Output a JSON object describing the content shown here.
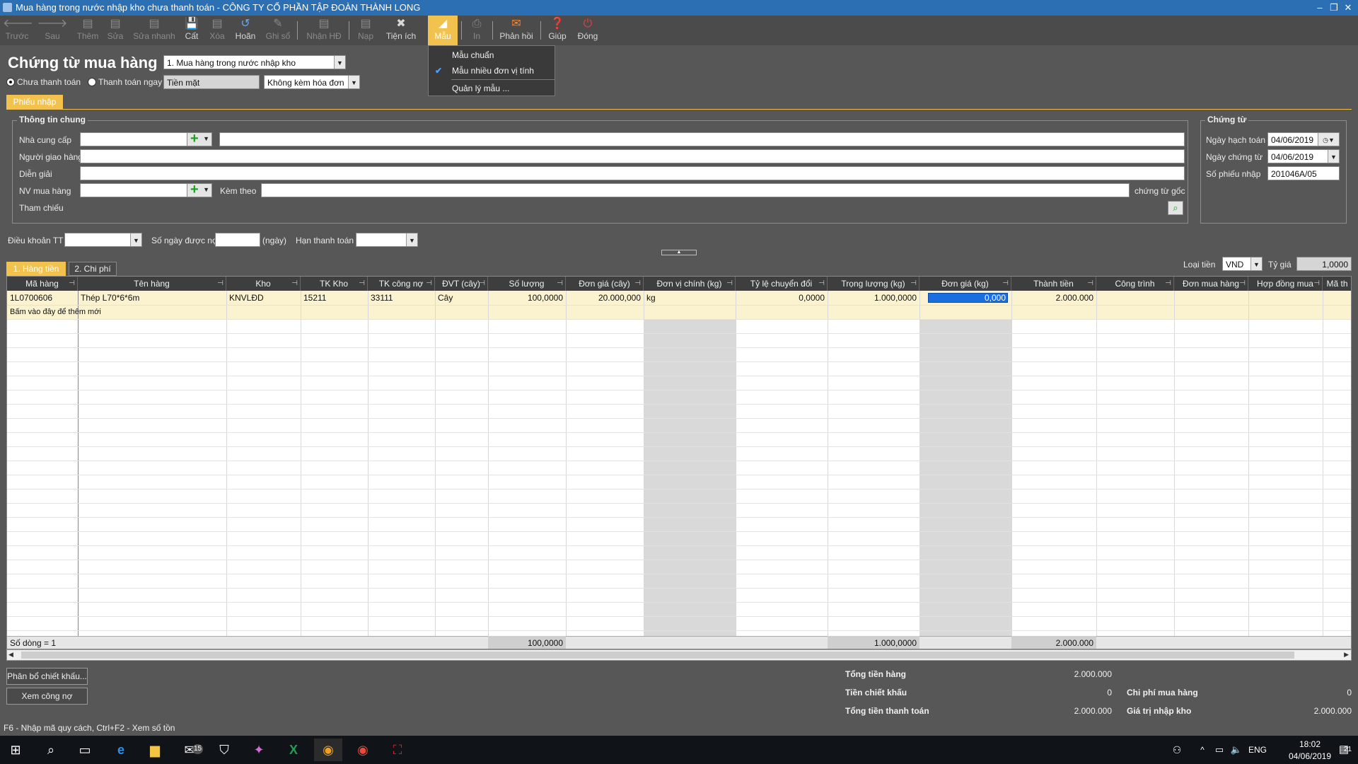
{
  "window": {
    "title": "Mua hàng trong nước nhập kho chưa thanh toán - CÔNG TY CỔ PHẦN TẬP ĐOÀN THÀNH LONG"
  },
  "toolbar": {
    "items": [
      {
        "name": "back",
        "label": "Trước",
        "icon": "arrow-left-icon",
        "disabled": true
      },
      {
        "name": "next",
        "label": "Sau",
        "icon": "arrow-right-icon",
        "disabled": true
      },
      {
        "name": "add",
        "label": "Thêm",
        "icon": "add-doc-icon",
        "disabled": true
      },
      {
        "name": "edit",
        "label": "Sửa",
        "icon": "edit-doc-icon",
        "disabled": true
      },
      {
        "name": "quick-edit",
        "label": "Sửa nhanh",
        "icon": "quick-edit-icon",
        "disabled": true
      },
      {
        "name": "save",
        "label": "Cất",
        "icon": "save-icon",
        "disabled": false
      },
      {
        "name": "delete",
        "label": "Xóa",
        "icon": "delete-icon",
        "disabled": true
      },
      {
        "name": "undo",
        "label": "Hoãn",
        "icon": "undo-icon",
        "disabled": false
      },
      {
        "name": "post",
        "label": "Ghi sổ",
        "icon": "pencil-icon",
        "disabled": true
      },
      {
        "name": "receive-invoice",
        "label": "Nhận HĐ",
        "icon": "invoice-icon",
        "disabled": true
      },
      {
        "name": "load",
        "label": "Nạp",
        "icon": "load-icon",
        "disabled": true
      },
      {
        "name": "utilities",
        "label": "Tiện ích",
        "icon": "tools-icon",
        "disabled": false
      },
      {
        "name": "template",
        "label": "Mẫu",
        "icon": "template-icon",
        "disabled": false,
        "active": true
      },
      {
        "name": "print",
        "label": "In",
        "icon": "printer-icon",
        "disabled": true
      },
      {
        "name": "feedback",
        "label": "Phản hồi",
        "icon": "mail-icon",
        "disabled": false
      },
      {
        "name": "help",
        "label": "Giúp",
        "icon": "help-icon",
        "disabled": false
      },
      {
        "name": "close",
        "label": "Đóng",
        "icon": "close-icon",
        "disabled": false
      }
    ]
  },
  "template_menu": {
    "items": [
      {
        "label": "Mẫu chuẩn",
        "checked": false
      },
      {
        "label": "Mẫu nhiều đơn vị tính",
        "checked": true
      },
      {
        "label": "Quản lý mẫu ...",
        "checked": false
      }
    ]
  },
  "header": {
    "title": "Chứng từ mua hàng",
    "doc_type": "1. Mua hàng trong nước nhập kho",
    "pay_unpaid": "Chưa thanh toán",
    "pay_now": "Thanh toán ngay",
    "pay_method": "Tiền mặt",
    "invoice_option": "Không kèm hóa đơn"
  },
  "tabs": {
    "receipt": "Phiếu nhập"
  },
  "general": {
    "title": "Thông tin chung",
    "supplier": "Nhà cung cấp",
    "deliverer": "Người giao hàng",
    "description": "Diễn giải",
    "buyer": "NV mua hàng",
    "attached": "Kèm theo",
    "attached_suffix": "chứng từ gốc",
    "reference": "Tham chiếu"
  },
  "voucher": {
    "title": "Chứng từ",
    "posting_date_label": "Ngày hạch toán",
    "posting_date": "04/06/2019",
    "doc_date_label": "Ngày chứng từ",
    "doc_date": "04/06/2019",
    "number_label": "Số phiếu nhập",
    "number": "201046A/05"
  },
  "terms": {
    "payment_terms": "Điều khoản TT",
    "days_label": "Số ngày được nợ",
    "days_unit": "(ngày)",
    "due_label": "Hạn thanh toán"
  },
  "detail_tabs": [
    "1. Hàng tiền",
    "2. Chi phí"
  ],
  "currency": {
    "label": "Loại tiền",
    "value": "VND",
    "rate_label": "Tỷ giá",
    "rate": "1,0000"
  },
  "grid": {
    "columns": [
      "Mã hàng",
      "Tên hàng",
      "Kho",
      "TK Kho",
      "TK công nợ",
      "ĐVT (cây)",
      "Số lượng",
      "Đơn giá (cây)",
      "Đơn vị chính (kg)",
      "Tỷ lệ chuyển đổi",
      "Trọng lượng (kg)",
      "Đơn giá (kg)",
      "Thành tiền",
      "Công trình",
      "Đơn mua hàng",
      "Hợp đồng mua",
      "Mã th"
    ],
    "rows": [
      [
        "1L0700606",
        "Thép L70*6*6m",
        "KNVLĐD",
        "15211",
        "33111",
        "Cây",
        "100,0000",
        "20.000,000",
        "kg",
        "0,0000",
        "1.000,0000",
        "0,000",
        "2.000.000",
        "",
        "",
        "",
        ""
      ]
    ],
    "new_row": "Bấm vào đây để thêm mới",
    "footer": {
      "count": "Số dòng = 1",
      "qty": "100,0000",
      "weight": "1.000,0000",
      "amount": "2.000.000"
    }
  },
  "buttons": {
    "discount": "Phân bổ chiết khấu...",
    "debt": "Xem công nợ"
  },
  "summary": {
    "goods_label": "Tổng tiền hàng",
    "goods": "2.000.000",
    "discount_label": "Tiền chiết khấu",
    "discount": "0",
    "total_label": "Tổng tiền thanh toán",
    "total": "2.000.000",
    "cost_label": "Chi phí mua hàng",
    "cost": "0",
    "stock_value_label": "Giá trị nhập kho",
    "stock_value": "2.000.000"
  },
  "statusbar": {
    "text": "F6 - Nhập mã quy cách, Ctrl+F2 - Xem số tồn"
  },
  "taskbar": {
    "lang": "ENG",
    "time": "18:02",
    "date": "04/06/2019",
    "mail_badge": "15",
    "notif_badge": "21"
  }
}
